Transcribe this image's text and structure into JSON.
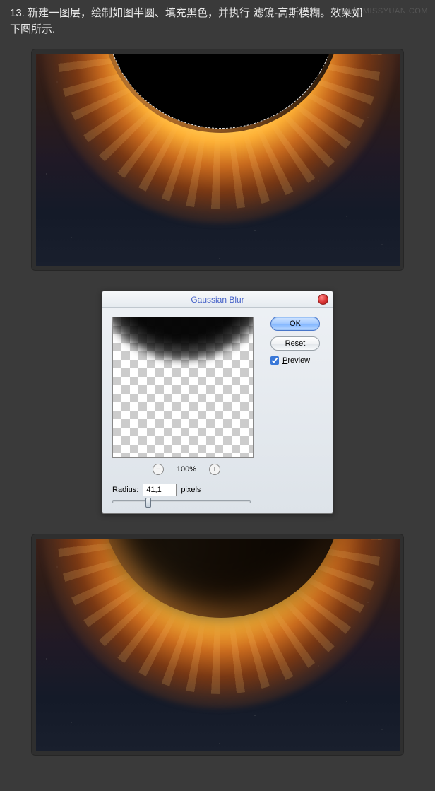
{
  "watermark": "WWW.MISSYUAN.COM",
  "step": {
    "number": "13.",
    "text_part1": "新建一图层，绘制如图半圆、填充黑色，并执行 滤镜-高斯模糊。效果如",
    "text_part2": "下图所示."
  },
  "dialog": {
    "title": "Gaussian Blur",
    "ok_label": "OK",
    "reset_label": "Reset",
    "preview_label_prefix": "P",
    "preview_label_rest": "review",
    "zoom_value": "100%",
    "radius_label_prefix": "R",
    "radius_label_rest": "adius:",
    "radius_value": "41,1",
    "radius_unit": "pixels"
  },
  "icons": {
    "zoom_out": "−",
    "zoom_in": "+"
  }
}
